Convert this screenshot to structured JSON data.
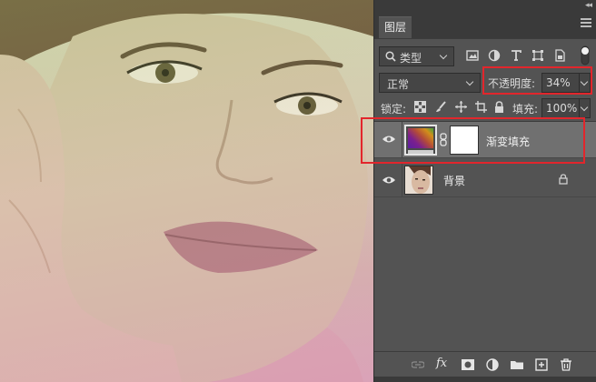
{
  "panel": {
    "tab_label": "图层",
    "filter": {
      "kind_label": "类型"
    },
    "blend_mode": "正常",
    "opacity_label": "不透明度:",
    "opacity_value": "34%",
    "lock_label": "锁定:",
    "fill_label": "填充:",
    "fill_value": "100%"
  },
  "layers": [
    {
      "name": "渐变填充",
      "type": "gradient-fill",
      "visible": true,
      "selected": true
    },
    {
      "name": "背景",
      "type": "image",
      "visible": true,
      "locked": true
    }
  ],
  "colors": {
    "highlight": "#e2262c",
    "panel_bg": "#535353",
    "selected_row": "#707070"
  }
}
